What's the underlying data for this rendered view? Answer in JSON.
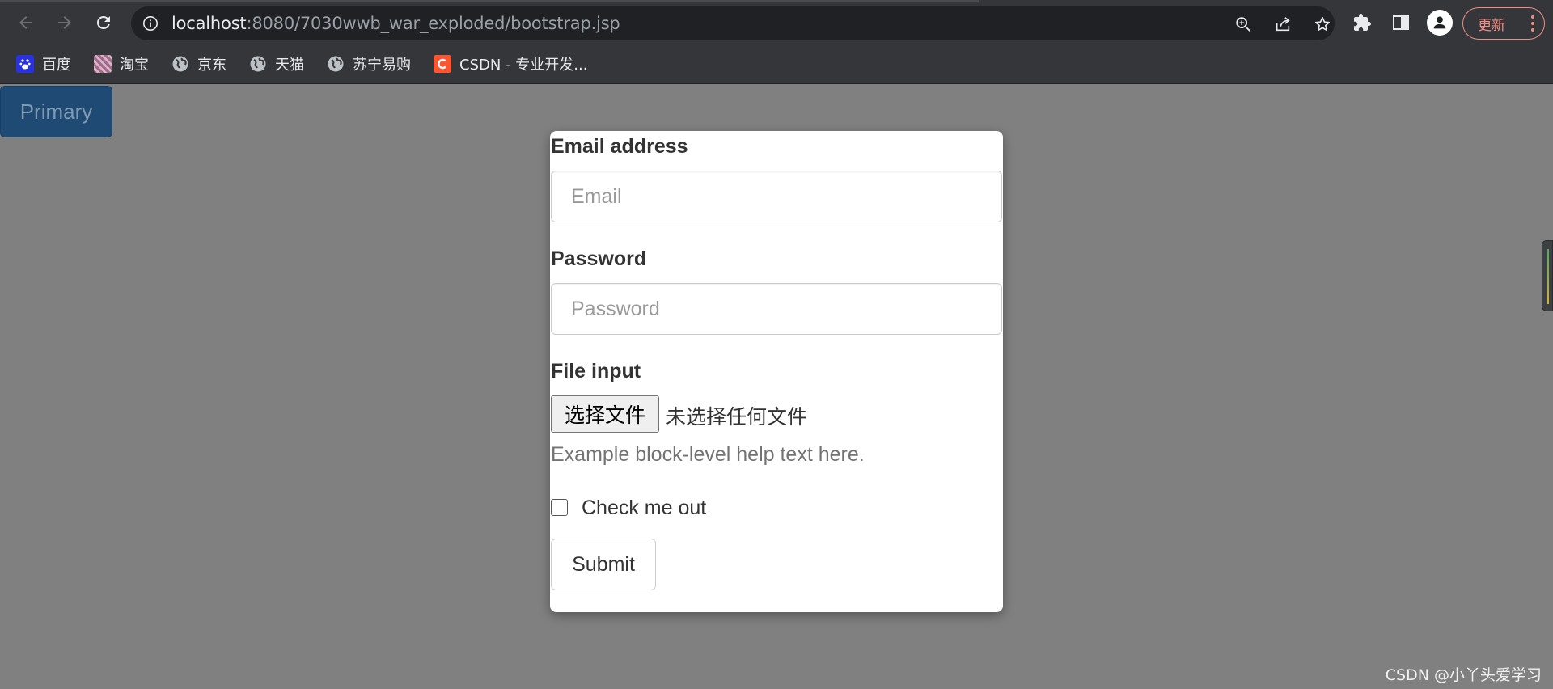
{
  "browser": {
    "address": {
      "host": "localhost",
      "rest": ":8080/7030wwb_war_exploded/bootstrap.jsp"
    },
    "update_label": "更新",
    "icons": {
      "back": "arrow-left-icon",
      "forward": "arrow-right-icon",
      "reload": "reload-icon",
      "site_info": "info-icon",
      "zoom": "zoom-icon",
      "share": "share-icon",
      "bookmark": "star-icon",
      "extensions": "puzzle-icon",
      "side_panel": "side-panel-icon",
      "profile": "profile-icon",
      "menu": "kebab-menu-icon"
    }
  },
  "bookmarks": [
    {
      "label": "百度",
      "icon": "baidu-icon"
    },
    {
      "label": "淘宝",
      "icon": "taobao-icon"
    },
    {
      "label": "京东",
      "icon": "globe-icon"
    },
    {
      "label": "天猫",
      "icon": "globe-icon"
    },
    {
      "label": "苏宁易购",
      "icon": "globe-icon"
    },
    {
      "label": "CSDN - 专业开发...",
      "icon": "csdn-icon"
    }
  ],
  "page": {
    "primary_button": "Primary"
  },
  "form": {
    "email": {
      "label": "Email address",
      "placeholder": "Email",
      "value": ""
    },
    "password": {
      "label": "Password",
      "placeholder": "Password",
      "value": ""
    },
    "file": {
      "label": "File input",
      "button_label": "选择文件",
      "status": "未选择任何文件",
      "help": "Example block-level help text here."
    },
    "checkbox": {
      "label": "Check me out",
      "checked": false
    },
    "submit_label": "Submit"
  },
  "watermark": "CSDN @小丫头爱学习",
  "colors": {
    "chrome": "#35363a",
    "omnibox": "#202124",
    "overlay": "#808080",
    "primary_dimmed": "#1e4a74",
    "update_accent": "#f28b82"
  }
}
